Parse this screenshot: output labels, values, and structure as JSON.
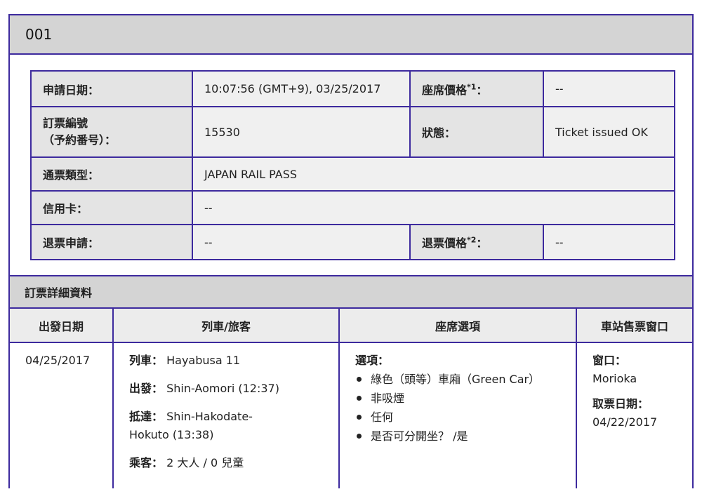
{
  "card": {
    "title": "001"
  },
  "summary": {
    "apply_date_label": "申請日期：",
    "apply_date_value": "10:07:56 (GMT+9), 03/25/2017",
    "seat_price_label": "座席價格",
    "seat_price_sup": "*1",
    "seat_price_colon": "：",
    "seat_price_value": "--",
    "booking_no_label_1": "訂票編號",
    "booking_no_label_2": "（予約番号）：",
    "booking_no_value": "15530",
    "status_label": "狀態：",
    "status_value": "Ticket issued OK",
    "pass_type_label": "通票類型：",
    "pass_type_value": "JAPAN RAIL PASS",
    "credit_card_label": "信用卡：",
    "credit_card_value": "--",
    "refund_request_label": "退票申請：",
    "refund_request_value": "--",
    "refund_price_label": "退票價格",
    "refund_price_sup": "*2",
    "refund_price_colon": "：",
    "refund_price_value": "--"
  },
  "detail": {
    "section_title": "訂票詳細資料",
    "columns": [
      "出發日期",
      "列車/旅客",
      "座席選項",
      "車站售票窗口"
    ],
    "departure_date": "04/25/2017",
    "train_label": "列車：",
    "train_value": "Hayabusa 11",
    "depart_label": "出發：",
    "depart_value": "Shin-Aomori (12:37)",
    "arrive_label": "抵達：",
    "arrive_value_1": "Shin-Hakodate-",
    "arrive_value_2": "Hokuto (13:38)",
    "passenger_label": "乘客：",
    "passenger_value": "2 大人 / 0 兒童",
    "options_label": "選項：",
    "options": [
      "綠色（頭等）車廂（Green Car）",
      "非吸煙",
      "任何",
      "是否可分開坐？ /是"
    ],
    "window_label": "窗口：",
    "window_value": "Morioka",
    "pickup_label": "取票日期：",
    "pickup_value": "04/22/2017"
  },
  "colors": {
    "border": "#3d2a9e",
    "header_bg": "#d4d4d4",
    "cell_bg": "#f0f0f0"
  }
}
